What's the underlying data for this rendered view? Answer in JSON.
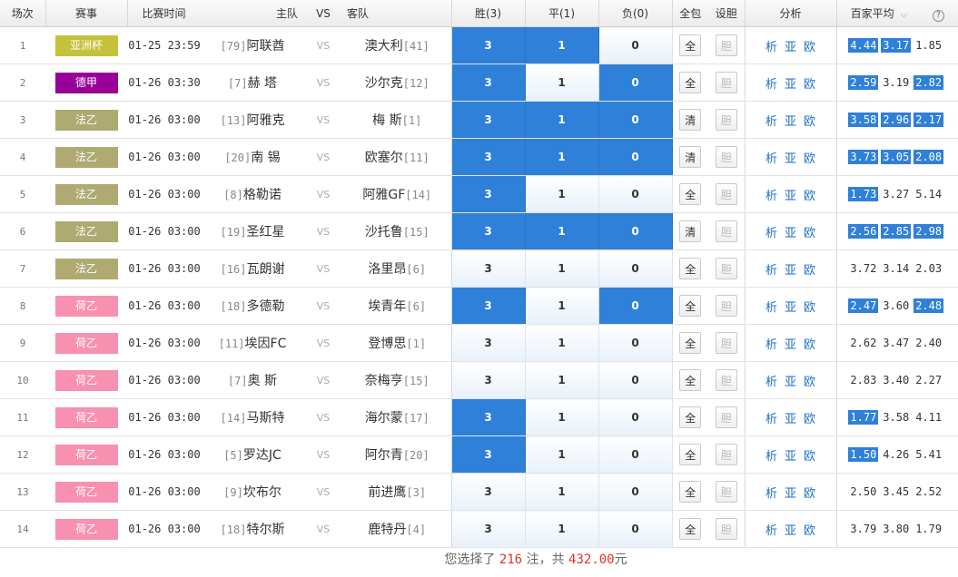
{
  "header": {
    "idx": "场次",
    "league": "赛事",
    "time": "比赛时间",
    "home": "主队",
    "vs": "VS",
    "away": "客队",
    "win": "胜(3)",
    "draw": "平(1)",
    "lose": "负(0)",
    "quanbao": "全包",
    "shedan": "设胆",
    "analysis": "分析",
    "avg": "百家平均",
    "avg_caret": "⌵",
    "help": "?"
  },
  "league_colors": {
    "亚洲杯": "#c5c13b",
    "德甲": "#990099",
    "法乙": "#aeaa72",
    "荷乙": "#f890b0"
  },
  "links": [
    "析",
    "亚",
    "欧"
  ],
  "rows": [
    {
      "idx": "1",
      "league": "亚洲杯",
      "time": "01-25 23:59",
      "home_rank": "[79]",
      "home": "阿联酋",
      "vs": "VS",
      "away": "澳大利",
      "away_rank": "[41]",
      "win": "3",
      "draw": "1",
      "lose": "0",
      "sel": [
        true,
        true,
        false
      ],
      "qb": "全",
      "dan": "胆",
      "odds": [
        "4.44",
        "3.17",
        "1.85"
      ],
      "hi": [
        true,
        true,
        false
      ]
    },
    {
      "idx": "2",
      "league": "德甲",
      "time": "01-26 03:30",
      "home_rank": "[7]",
      "home": "赫 塔",
      "vs": "VS",
      "away": "沙尔克",
      "away_rank": "[12]",
      "win": "3",
      "draw": "1",
      "lose": "0",
      "sel": [
        true,
        false,
        true
      ],
      "qb": "全",
      "dan": "胆",
      "odds": [
        "2.59",
        "3.19",
        "2.82"
      ],
      "hi": [
        true,
        false,
        true
      ]
    },
    {
      "idx": "3",
      "league": "法乙",
      "time": "01-26 03:00",
      "home_rank": "[13]",
      "home": "阿雅克",
      "vs": "VS",
      "away": "梅 斯",
      "away_rank": "[1]",
      "win": "3",
      "draw": "1",
      "lose": "0",
      "sel": [
        true,
        true,
        true
      ],
      "qb": "清",
      "dan": "胆",
      "odds": [
        "3.58",
        "2.96",
        "2.17"
      ],
      "hi": [
        true,
        true,
        true
      ]
    },
    {
      "idx": "4",
      "league": "法乙",
      "time": "01-26 03:00",
      "home_rank": "[20]",
      "home": "南 锡",
      "vs": "VS",
      "away": "欧塞尔",
      "away_rank": "[11]",
      "win": "3",
      "draw": "1",
      "lose": "0",
      "sel": [
        true,
        true,
        true
      ],
      "qb": "清",
      "dan": "胆",
      "odds": [
        "3.73",
        "3.05",
        "2.08"
      ],
      "hi": [
        true,
        true,
        true
      ]
    },
    {
      "idx": "5",
      "league": "法乙",
      "time": "01-26 03:00",
      "home_rank": "[8]",
      "home": "格勒诺",
      "vs": "VS",
      "away": "阿雅GF",
      "away_rank": "[14]",
      "win": "3",
      "draw": "1",
      "lose": "0",
      "sel": [
        true,
        false,
        false
      ],
      "qb": "全",
      "dan": "胆",
      "odds": [
        "1.73",
        "3.27",
        "5.14"
      ],
      "hi": [
        true,
        false,
        false
      ]
    },
    {
      "idx": "6",
      "league": "法乙",
      "time": "01-26 03:00",
      "home_rank": "[19]",
      "home": "圣红星",
      "vs": "VS",
      "away": "沙托鲁",
      "away_rank": "[15]",
      "win": "3",
      "draw": "1",
      "lose": "0",
      "sel": [
        true,
        true,
        true
      ],
      "qb": "清",
      "dan": "胆",
      "odds": [
        "2.56",
        "2.85",
        "2.98"
      ],
      "hi": [
        true,
        true,
        true
      ]
    },
    {
      "idx": "7",
      "league": "法乙",
      "time": "01-26 03:00",
      "home_rank": "[16]",
      "home": "瓦朗谢",
      "vs": "VS",
      "away": "洛里昂",
      "away_rank": "[6]",
      "win": "3",
      "draw": "1",
      "lose": "0",
      "sel": [
        false,
        false,
        false
      ],
      "qb": "全",
      "dan": "胆",
      "odds": [
        "3.72",
        "3.14",
        "2.03"
      ],
      "hi": [
        false,
        false,
        false
      ]
    },
    {
      "idx": "8",
      "league": "荷乙",
      "time": "01-26 03:00",
      "home_rank": "[18]",
      "home": "多德勒",
      "vs": "VS",
      "away": "埃青年",
      "away_rank": "[6]",
      "win": "3",
      "draw": "1",
      "lose": "0",
      "sel": [
        true,
        false,
        true
      ],
      "qb": "全",
      "dan": "胆",
      "odds": [
        "2.47",
        "3.60",
        "2.48"
      ],
      "hi": [
        true,
        false,
        true
      ]
    },
    {
      "idx": "9",
      "league": "荷乙",
      "time": "01-26 03:00",
      "home_rank": "[11]",
      "home": "埃因FC",
      "vs": "VS",
      "away": "登博思",
      "away_rank": "[1]",
      "win": "3",
      "draw": "1",
      "lose": "0",
      "sel": [
        false,
        false,
        false
      ],
      "qb": "全",
      "dan": "胆",
      "odds": [
        "2.62",
        "3.47",
        "2.40"
      ],
      "hi": [
        false,
        false,
        false
      ]
    },
    {
      "idx": "10",
      "league": "荷乙",
      "time": "01-26 03:00",
      "home_rank": "[7]",
      "home": "奥 斯",
      "vs": "VS",
      "away": "奈梅亨",
      "away_rank": "[15]",
      "win": "3",
      "draw": "1",
      "lose": "0",
      "sel": [
        false,
        false,
        false
      ],
      "qb": "全",
      "dan": "胆",
      "odds": [
        "2.83",
        "3.40",
        "2.27"
      ],
      "hi": [
        false,
        false,
        false
      ]
    },
    {
      "idx": "11",
      "league": "荷乙",
      "time": "01-26 03:00",
      "home_rank": "[14]",
      "home": "马斯特",
      "vs": "VS",
      "away": "海尔蒙",
      "away_rank": "[17]",
      "win": "3",
      "draw": "1",
      "lose": "0",
      "sel": [
        true,
        false,
        false
      ],
      "qb": "全",
      "dan": "胆",
      "odds": [
        "1.77",
        "3.58",
        "4.11"
      ],
      "hi": [
        true,
        false,
        false
      ]
    },
    {
      "idx": "12",
      "league": "荷乙",
      "time": "01-26 03:00",
      "home_rank": "[5]",
      "home": "罗达JC",
      "vs": "VS",
      "away": "阿尔青",
      "away_rank": "[20]",
      "win": "3",
      "draw": "1",
      "lose": "0",
      "sel": [
        true,
        false,
        false
      ],
      "qb": "全",
      "dan": "胆",
      "odds": [
        "1.50",
        "4.26",
        "5.41"
      ],
      "hi": [
        true,
        false,
        false
      ]
    },
    {
      "idx": "13",
      "league": "荷乙",
      "time": "01-26 03:00",
      "home_rank": "[9]",
      "home": "坎布尔",
      "vs": "VS",
      "away": "前进鹰",
      "away_rank": "[3]",
      "win": "3",
      "draw": "1",
      "lose": "0",
      "sel": [
        false,
        false,
        false
      ],
      "qb": "全",
      "dan": "胆",
      "odds": [
        "2.50",
        "3.45",
        "2.52"
      ],
      "hi": [
        false,
        false,
        false
      ]
    },
    {
      "idx": "14",
      "league": "荷乙",
      "time": "01-26 03:00",
      "home_rank": "[18]",
      "home": "特尔斯",
      "vs": "VS",
      "away": "鹿特丹",
      "away_rank": "[4]",
      "win": "3",
      "draw": "1",
      "lose": "0",
      "sel": [
        false,
        false,
        false
      ],
      "qb": "全",
      "dan": "胆",
      "odds": [
        "3.79",
        "3.80",
        "1.79"
      ],
      "hi": [
        false,
        false,
        false
      ]
    }
  ],
  "footer": {
    "prefix": "您选择了",
    "bets": "216",
    "mid": "注，共",
    "amount": "432.00",
    "suffix": "元"
  }
}
